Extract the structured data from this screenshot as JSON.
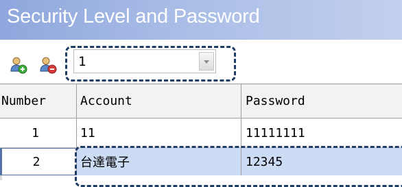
{
  "window": {
    "title": "Security Level and Password"
  },
  "toolbar": {
    "add_icon": "add-user-icon",
    "delete_icon": "delete-user-icon",
    "level_select": {
      "value": "1"
    }
  },
  "grid": {
    "columns": [
      "Number",
      "Account",
      "Password"
    ],
    "rows": [
      {
        "number": "1",
        "account": "11",
        "password": "11111111"
      },
      {
        "number": "2",
        "account": "台達電子",
        "password": "12345"
      }
    ],
    "selected_row": 2
  },
  "colors": {
    "title_gradient_start": "#8fa7dd",
    "title_gradient_end": "#c3d0ee",
    "selected_row": "#ccdcf4",
    "callout": "#1f3c64"
  }
}
